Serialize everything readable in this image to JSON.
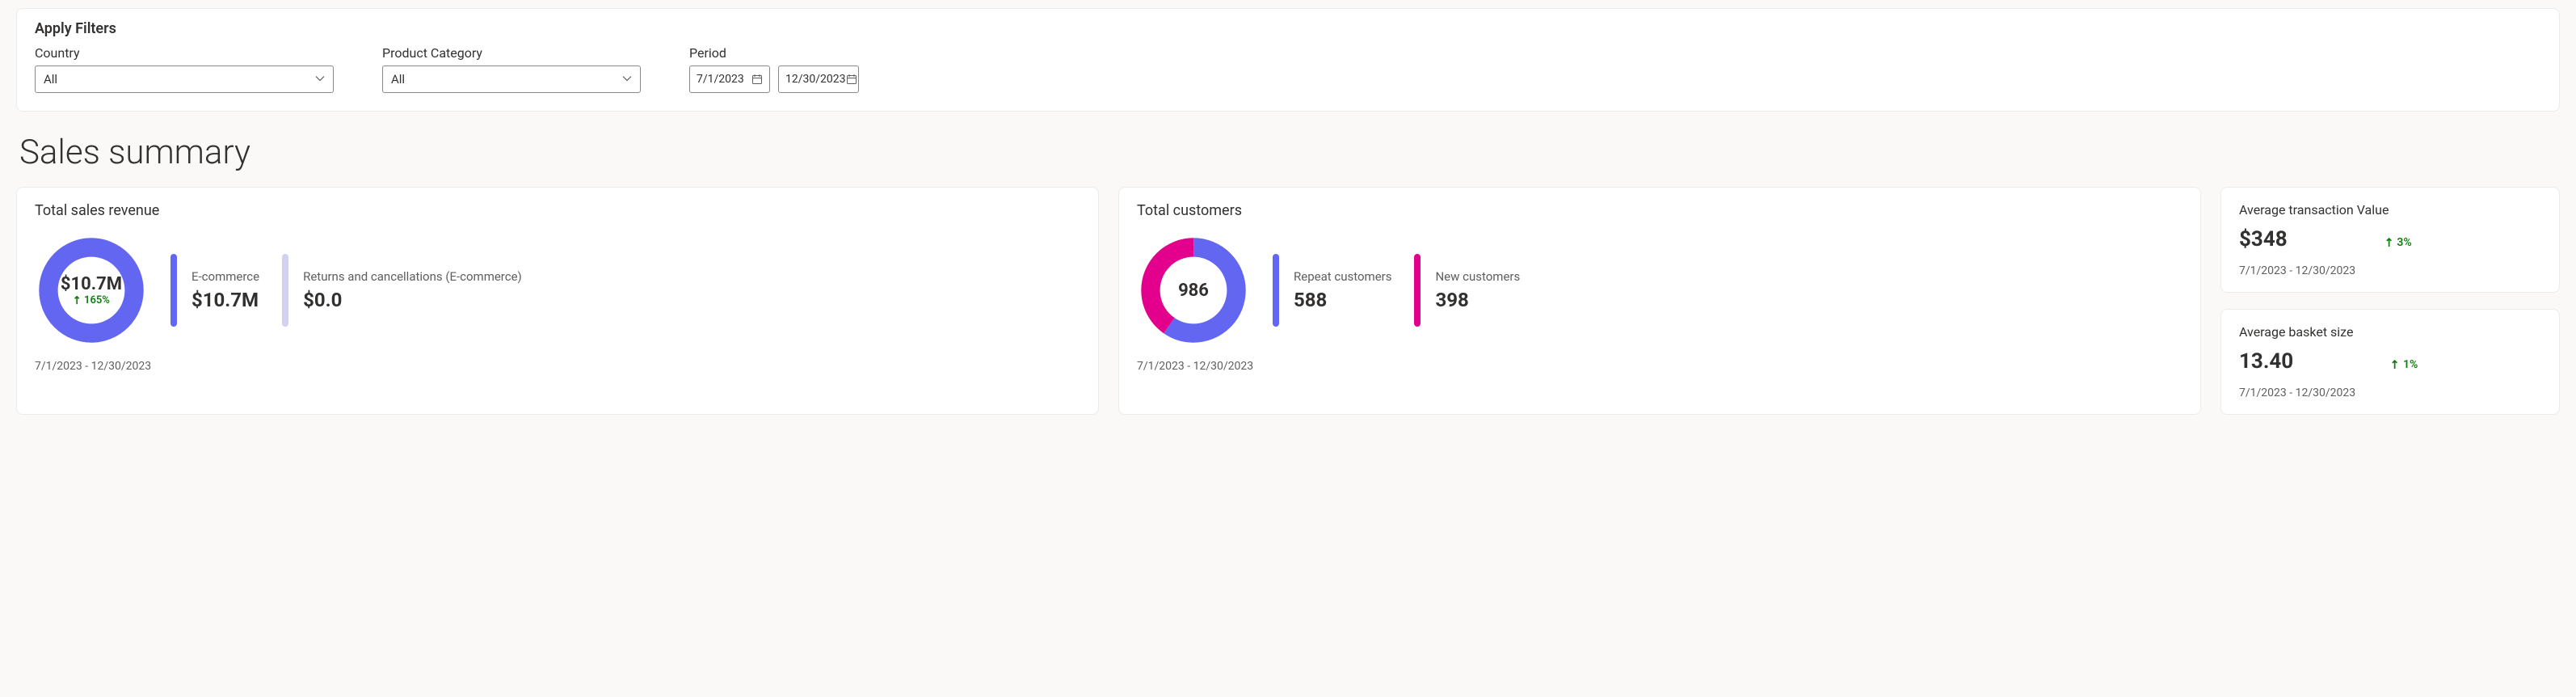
{
  "filters": {
    "title": "Apply Filters",
    "country": {
      "label": "Country",
      "value": "All"
    },
    "product_category": {
      "label": "Product Category",
      "value": "All"
    },
    "period": {
      "label": "Period",
      "start": "7/1/2023",
      "end": "12/30/2023"
    }
  },
  "page_title": "Sales summary",
  "cards": {
    "total_sales": {
      "title": "Total sales revenue",
      "center_value": "$10.7M",
      "delta": "165%",
      "period": "7/1/2023 - 12/30/2023",
      "ecommerce": {
        "label": "E-commerce",
        "value": "$10.7M"
      },
      "returns": {
        "label": "Returns and cancellations (E-commerce)",
        "value": "$0.0"
      }
    },
    "total_customers": {
      "title": "Total customers",
      "center_value": "986",
      "period": "7/1/2023 - 12/30/2023",
      "repeat": {
        "label": "Repeat customers",
        "value": "588"
      },
      "new": {
        "label": "New customers",
        "value": "398"
      }
    },
    "avg_transaction": {
      "title": "Average transaction Value",
      "value": "$348",
      "delta": "3%",
      "period": "7/1/2023 - 12/30/2023"
    },
    "avg_basket": {
      "title": "Average basket size",
      "value": "13.40",
      "delta": "1%",
      "period": "7/1/2023 - 12/30/2023"
    }
  },
  "colors": {
    "blue": "#6366f1",
    "pink": "#e3008c",
    "lavender": "#d1d1f0",
    "green": "#107c10"
  },
  "chart_data": [
    {
      "type": "pie",
      "title": "Total sales revenue",
      "series": [
        {
          "name": "E-commerce",
          "value": 10.7,
          "unit": "$M",
          "color": "#6366f1"
        },
        {
          "name": "Returns and cancellations (E-commerce)",
          "value": 0.0,
          "unit": "$M",
          "color": "#d1d1f0"
        }
      ],
      "total_label": "$10.7M",
      "delta_pct": 165
    },
    {
      "type": "pie",
      "title": "Total customers",
      "series": [
        {
          "name": "Repeat customers",
          "value": 588,
          "color": "#6366f1"
        },
        {
          "name": "New customers",
          "value": 398,
          "color": "#e3008c"
        }
      ],
      "total_label": "986"
    }
  ]
}
